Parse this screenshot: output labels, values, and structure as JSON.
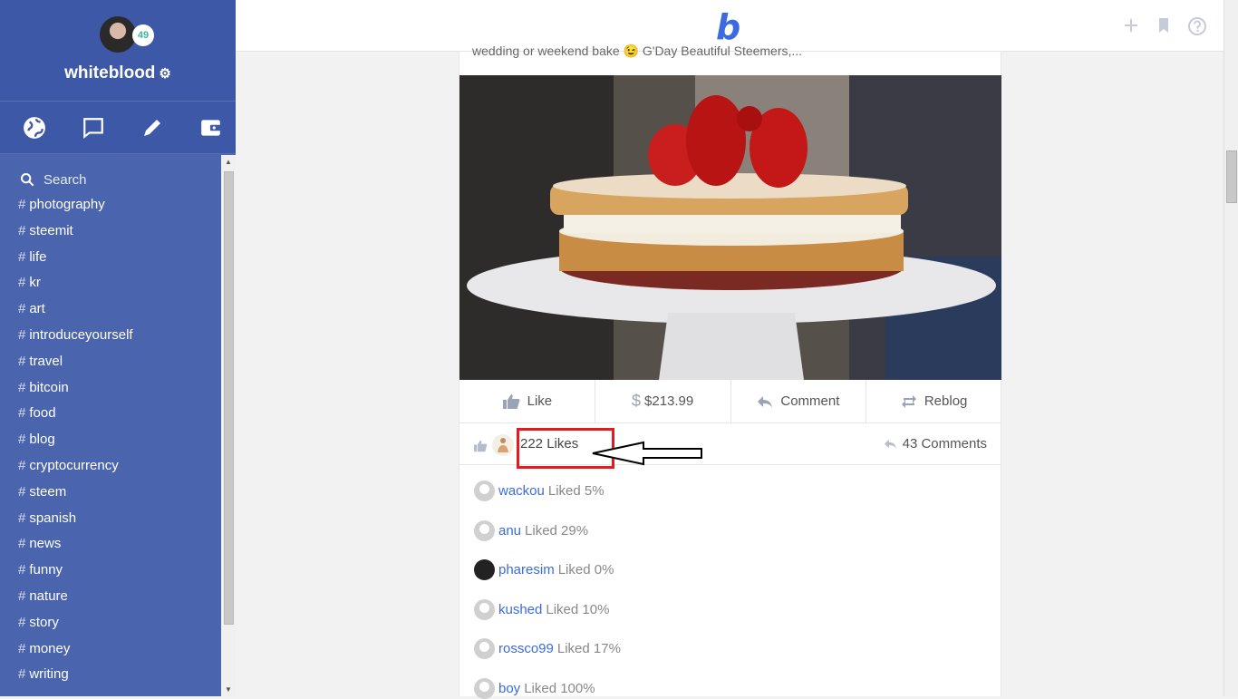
{
  "profile": {
    "username": "whiteblood",
    "badge": "49"
  },
  "sidebar": {
    "nav_icons": [
      "globe-icon",
      "chat-icon",
      "pencil-icon",
      "wallet-icon"
    ],
    "search_placeholder": "Search",
    "tags": [
      "photography",
      "steemit",
      "life",
      "kr",
      "art",
      "introduceyourself",
      "travel",
      "bitcoin",
      "food",
      "blog",
      "cryptocurrency",
      "steem",
      "spanish",
      "news",
      "funny",
      "nature",
      "story",
      "money",
      "writing"
    ]
  },
  "topbar": {
    "logo": "b"
  },
  "post": {
    "caption": "wedding or weekend bake 😉 G'Day Beautiful Steemers,...",
    "actions": {
      "like": "Like",
      "payout": "$213.99",
      "comment": "Comment",
      "reblog": "Reblog"
    },
    "likes_label": "222 Likes",
    "comments_label": "43 Comments",
    "voters": [
      {
        "name": "wackou",
        "text": "Liked 5%"
      },
      {
        "name": "anu",
        "text": "Liked 29%"
      },
      {
        "name": "pharesim",
        "text": "Liked 0%"
      },
      {
        "name": "kushed",
        "text": "Liked 10%"
      },
      {
        "name": "rossco99",
        "text": "Liked 17%"
      },
      {
        "name": "boy",
        "text": "Liked 100%"
      }
    ]
  },
  "colors": {
    "sidebar": "#4a65ad",
    "accent": "#3b6be0",
    "highlight": "#e21b23"
  }
}
